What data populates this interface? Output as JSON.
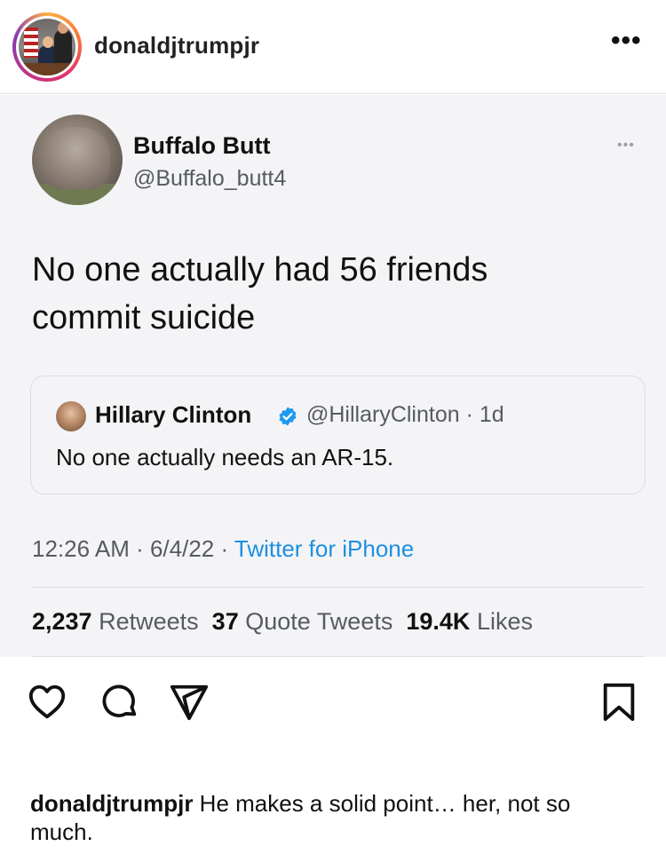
{
  "header": {
    "username": "donaldjtrumpjr",
    "more_icon": "ellipsis-icon",
    "more_label": "•••"
  },
  "tweet": {
    "author_name": "Buffalo Butt",
    "author_handle": "@Buffalo_butt4",
    "more_label": "•••",
    "text": "No one actually had 56 friends commit suicide",
    "quote": {
      "author_name": "Hillary Clinton",
      "verified": true,
      "handle_time": "@HillaryClinton · 1d",
      "text": "No one actually needs an AR-15."
    },
    "time_date": "12:26 AM · 6/4/22 · ",
    "source": "Twitter for iPhone",
    "stats": {
      "retweets_count": "2,237",
      "retweets_label": "Retweets",
      "quotes_count": "37",
      "quotes_label": "Quote Tweets",
      "likes_count": "19.4K",
      "likes_label": "Likes"
    }
  },
  "actions": {
    "like_icon": "heart-icon",
    "comment_icon": "comment-icon",
    "share_icon": "send-icon",
    "save_icon": "bookmark-icon"
  },
  "caption": {
    "username": "donaldjtrumpjr",
    "text": " He makes a solid point… her, not so much."
  },
  "colors": {
    "link_blue": "#1d8fe0",
    "verified_blue": "#1d9bf0",
    "tweet_bg": "#f4f4f7"
  }
}
